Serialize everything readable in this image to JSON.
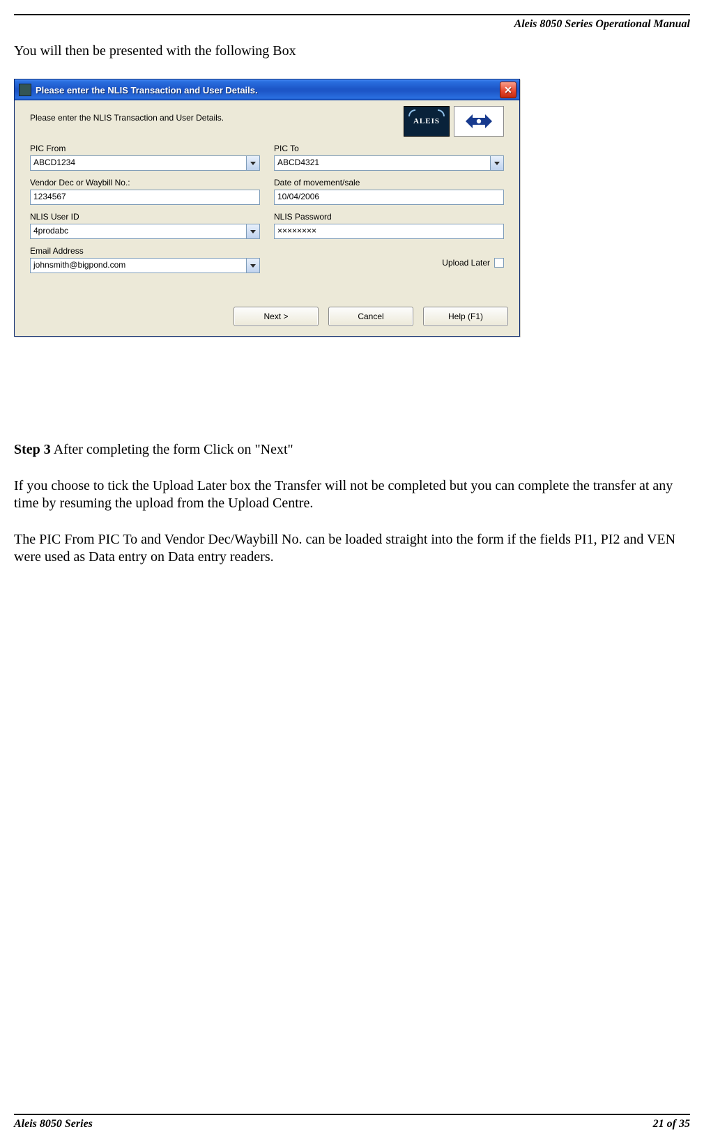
{
  "header": {
    "running_title": "Aleis 8050 Series Operational Manual"
  },
  "intro_text": "You will then be presented with the following Box",
  "dialog": {
    "title": "Please enter the NLIS Transaction and User Details.",
    "prompt": "Please enter the NLIS Transaction and User Details.",
    "logos": {
      "aleis_text": "ALEIS"
    },
    "fields": {
      "pic_from": {
        "label": "PIC From",
        "value": "ABCD1234"
      },
      "pic_to": {
        "label": "PIC To",
        "value": "ABCD4321"
      },
      "waybill": {
        "label": "Vendor Dec or Waybill No.:",
        "value": "1234567"
      },
      "move_date": {
        "label": "Date of movement/sale",
        "value": "10/04/2006"
      },
      "nlis_user": {
        "label": "NLIS User ID",
        "value": "4prodabc"
      },
      "nlis_pass": {
        "label": "NLIS Password",
        "value": "××××××××"
      },
      "email": {
        "label": "Email Address",
        "value": "johnsmith@bigpond.com"
      },
      "upload_later_label": "Upload Later"
    },
    "buttons": {
      "next": "Next >",
      "cancel": "Cancel",
      "help": "Help (F1)"
    }
  },
  "body": {
    "step3_label": "Step 3",
    "step3_rest": " After completing the form Click on \"Next\"",
    "para2": "If you choose to tick the Upload Later box the Transfer will not be completed but you can complete the transfer at any time by  resuming the upload from the Upload Centre.",
    "para3": "The PIC From PIC To and Vendor Dec/Waybill No. can be loaded straight into the form if the fields PI1, PI2 and VEN were used as Data entry on Data entry readers."
  },
  "footer": {
    "left": "Aleis 8050 Series",
    "right": "21 of 35"
  }
}
